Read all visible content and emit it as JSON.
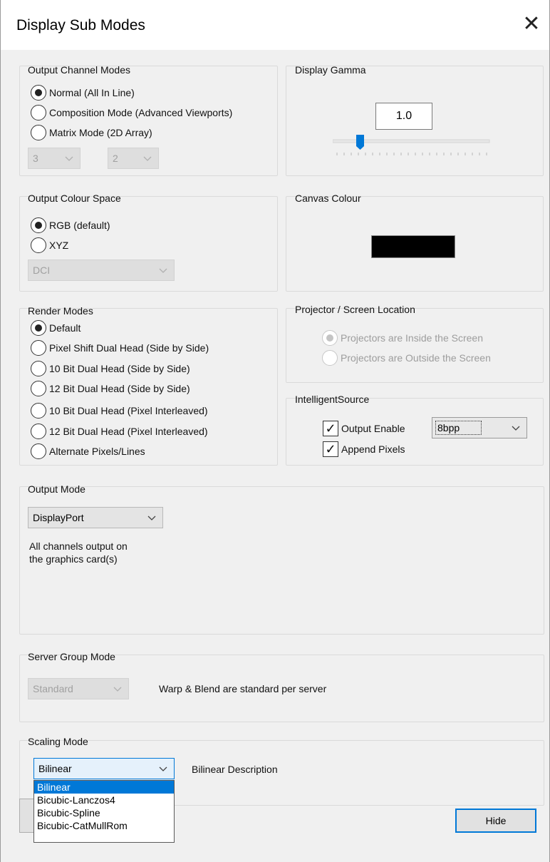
{
  "window": {
    "title": "Display Sub Modes",
    "close_icon": "close-icon"
  },
  "output_channel_modes": {
    "label": "Output Channel Modes",
    "options": [
      {
        "label": "Normal   (All In Line)",
        "selected": true
      },
      {
        "label": "Composition Mode (Advanced Viewports)",
        "selected": false
      },
      {
        "label": "Matrix Mode  (2D Array)",
        "selected": false
      }
    ],
    "matrix_cols": "3",
    "matrix_rows": "2"
  },
  "display_gamma": {
    "label": "Display Gamma",
    "value": "1.0"
  },
  "output_colour_space": {
    "label": "Output Colour Space",
    "options": [
      {
        "label": "RGB (default)",
        "selected": true
      },
      {
        "label": "XYZ",
        "selected": false
      }
    ],
    "profile": "DCI"
  },
  "canvas_colour": {
    "label": "Canvas Colour",
    "swatch_color": "#000000"
  },
  "render_modes": {
    "label": "Render Modes",
    "options": [
      {
        "label": "Default",
        "selected": true
      },
      {
        "label": "Pixel Shift Dual Head (Side by Side)",
        "selected": false
      },
      {
        "label": "10 Bit Dual Head (Side by Side)",
        "selected": false
      },
      {
        "label": "12 Bit Dual Head (Side by Side)",
        "selected": false
      },
      {
        "label": "10 Bit Dual Head (Pixel Interleaved)",
        "selected": false
      },
      {
        "label": "12 Bit Dual Head (Pixel Interleaved)",
        "selected": false
      },
      {
        "label": "Alternate Pixels/Lines",
        "selected": false
      }
    ]
  },
  "projector_location": {
    "label": "Projector / Screen Location",
    "options": [
      {
        "label": "Projectors are Inside the Screen",
        "selected": true
      },
      {
        "label": "Projectors are Outside the Screen",
        "selected": false
      }
    ]
  },
  "intelligent_source": {
    "label": "IntelligentSource",
    "output_enable_label": "Output Enable",
    "output_enable_checked": true,
    "bpp_value": "8bpp",
    "append_pixels_label": "Append Pixels",
    "append_pixels_checked": true
  },
  "output_mode": {
    "label": "Output Mode",
    "value": "DisplayPort",
    "description_line1": "All channels output on",
    "description_line2": "the graphics card(s)"
  },
  "server_group_mode": {
    "label": "Server Group Mode",
    "value": "Standard",
    "description": "Warp & Blend are standard per server"
  },
  "scaling_mode": {
    "label": "Scaling Mode",
    "value": "Bilinear",
    "description": "Bilinear Description",
    "options": [
      "Bilinear",
      "Bicubic-Lanczos4",
      "Bicubic-Spline",
      "Bicubic-CatMullRom"
    ],
    "highlighted_index": 0
  },
  "hide_button": "Hide",
  "colors": {
    "accent": "#0078d7",
    "window_bg": "#f0f0f0",
    "slider_thumb": "#0078d7"
  }
}
